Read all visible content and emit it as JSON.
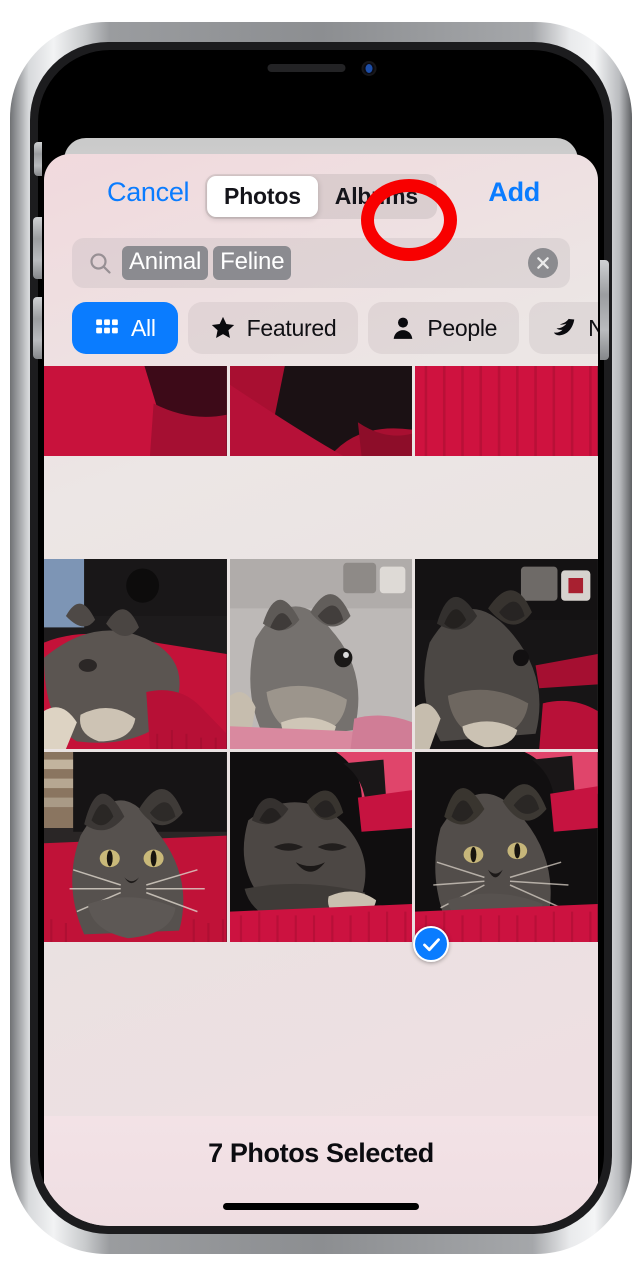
{
  "device": {
    "notch": {
      "speaker": "earpiece-speaker",
      "camera": "front-camera"
    },
    "buttons": [
      "mute-switch",
      "volume-up",
      "volume-down",
      "power-button"
    ]
  },
  "nav": {
    "cancel_label": "Cancel",
    "add_label": "Add",
    "segments": [
      {
        "label": "Photos",
        "selected": true
      },
      {
        "label": "Albums",
        "selected": false
      }
    ]
  },
  "search": {
    "icon": "search-icon",
    "tokens": [
      "Animal",
      "Feline"
    ],
    "clear_icon": "close-circle-icon",
    "placeholder": ""
  },
  "filters": [
    {
      "label": "All",
      "icon": "grid-icon",
      "active": true
    },
    {
      "label": "Featured",
      "icon": "star-icon",
      "active": false
    },
    {
      "label": "People",
      "icon": "person-icon",
      "active": false
    },
    {
      "label": "Nature",
      "icon": "leaf-icon",
      "active": false
    }
  ],
  "grid": {
    "cells": [
      {
        "name": "photo-thumbnail-1",
        "selected": false
      },
      {
        "name": "photo-thumbnail-2",
        "selected": false
      },
      {
        "name": "photo-thumbnail-3",
        "selected": false
      },
      {
        "name": "photo-thumbnail-4",
        "selected": false
      },
      {
        "name": "photo-thumbnail-5",
        "selected": true
      },
      {
        "name": "photo-thumbnail-6",
        "selected": false
      },
      {
        "name": "photo-thumbnail-7",
        "selected": false
      },
      {
        "name": "photo-thumbnail-8",
        "selected": false
      },
      {
        "name": "photo-thumbnail-9",
        "selected": false
      }
    ],
    "checkmark_icon": "checkmark-icon"
  },
  "footer": {
    "status": "7 Photos Selected"
  },
  "annotation": {
    "type": "ellipse-highlight",
    "target": "Albums",
    "color": "#f80000"
  },
  "colors": {
    "accent_blue": "#0a7cff",
    "annotation_red": "#f80000",
    "token_gray": "#8b8b90",
    "sheet_pink": "#f1d9dd"
  }
}
